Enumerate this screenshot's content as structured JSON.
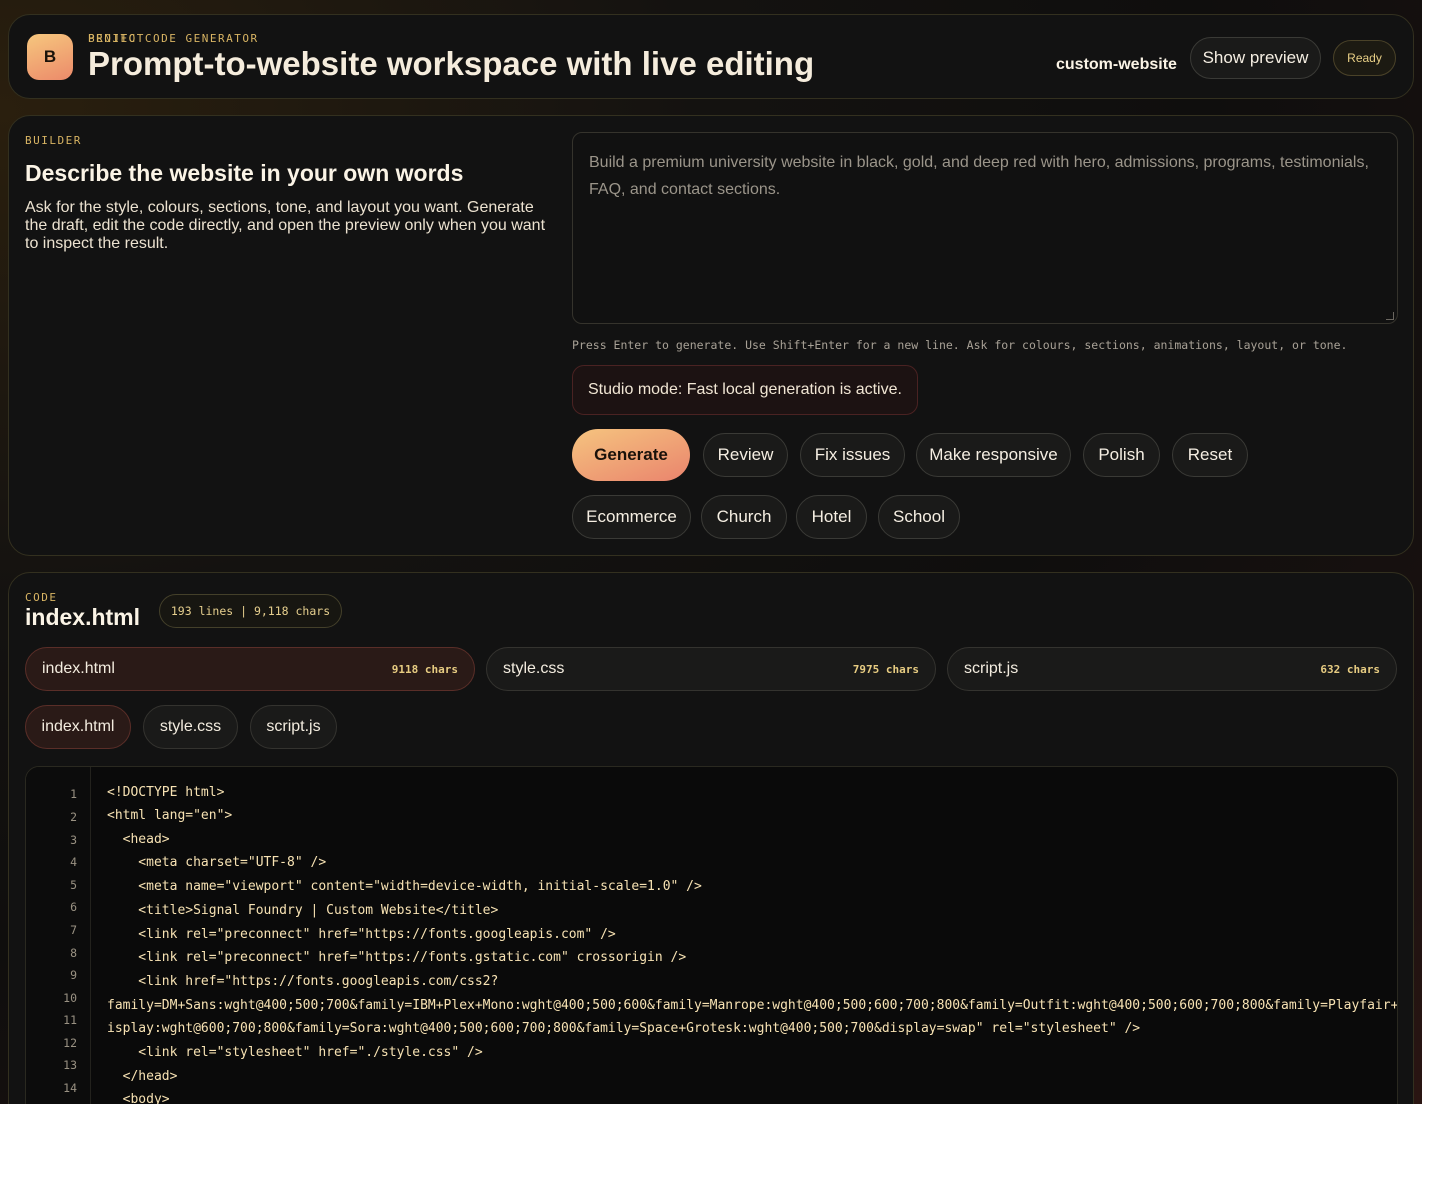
{
  "header": {
    "logo_letter": "B",
    "eyebrow": "BENITO CODE GENERATOR",
    "title": "Prompt-to-website workspace with live editing",
    "project_label": "PROJECT",
    "project_name": "custom-website",
    "show_preview_label": "Show preview",
    "status": "Ready"
  },
  "builder": {
    "eyebrow": "BUILDER",
    "title": "Describe the website in your own words",
    "description": "Ask for the style, colours, sections, tone, and layout you want. Generate the draft, edit the code directly, and open the preview only when you want to inspect the result.",
    "prompt_placeholder": "Build a premium university website in black, gold, and deep red with hero, admissions, programs, testimonials, FAQ, and contact sections.",
    "hint": "Press Enter to generate. Use Shift+Enter for a new line. Ask for colours, sections, animations, layout, or tone.",
    "studio_mode": "Studio mode: Fast local generation is active.",
    "generate_label": "Generate",
    "actions": [
      "Review",
      "Fix issues",
      "Make responsive",
      "Polish",
      "Reset"
    ],
    "templates": [
      "Ecommerce",
      "Church",
      "Hotel",
      "School"
    ]
  },
  "code": {
    "eyebrow": "CODE",
    "filename": "index.html",
    "stats": "193 lines | 9,118 chars",
    "files": [
      {
        "name": "index.html",
        "size": "9118 chars"
      },
      {
        "name": "style.css",
        "size": "7975 chars"
      },
      {
        "name": "script.js",
        "size": "632 chars"
      }
    ],
    "tabs": [
      "index.html",
      "style.css",
      "script.js"
    ],
    "line_numbers": [
      "1",
      "2",
      "3",
      "4",
      "5",
      "6",
      "7",
      "8",
      "9",
      "10",
      "11",
      "12",
      "13",
      "14"
    ],
    "lines": [
      "<!DOCTYPE html>",
      "<html lang=\"en\">",
      "  <head>",
      "    <meta charset=\"UTF-8\" />",
      "    <meta name=\"viewport\" content=\"width=device-width, initial-scale=1.0\" />",
      "    <title>Signal Foundry | Custom Website</title>",
      "    <link rel=\"preconnect\" href=\"https://fonts.googleapis.com\" />",
      "    <link rel=\"preconnect\" href=\"https://fonts.gstatic.com\" crossorigin />",
      "    <link href=\"https://fonts.googleapis.com/css2?",
      "family=DM+Sans:wght@400;500;700&family=IBM+Plex+Mono:wght@400;500;600&family=Manrope:wght@400;500;600;700;800&family=Outfit:wght@400;500;600;700;800&family=Playfair+D",
      "isplay:wght@600;700;800&family=Sora:wght@400;500;600;700;800&family=Space+Grotesk:wght@400;500;700&display=swap\" rel=\"stylesheet\" />",
      "    <link rel=\"stylesheet\" href=\"./style.css\" />",
      "  </head>",
      "  <body>"
    ]
  }
}
